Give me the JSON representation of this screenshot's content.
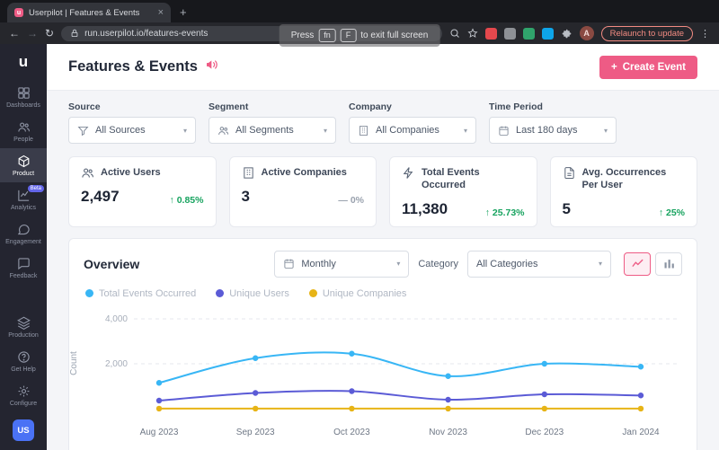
{
  "browser": {
    "tab_title": "Userpilot | Features & Events",
    "favicon_letter": "u",
    "close_glyph": "×",
    "newtab_glyph": "+",
    "back_glyph": "←",
    "forward_glyph": "→",
    "reload_glyph": "↻",
    "url": "run.userpilot.io/features-events",
    "relaunch_label": "Relaunch to update",
    "profile_initial": "A",
    "menu_glyph": "⋮",
    "toast": {
      "prefix": "Press",
      "key1": "fn",
      "key2": "F",
      "suffix": "to exit full screen"
    }
  },
  "sidebar": {
    "logo_letter": "u",
    "items": [
      {
        "label": "Dashboards"
      },
      {
        "label": "People"
      },
      {
        "label": "Product"
      },
      {
        "label": "Analytics",
        "badge": "Beta"
      },
      {
        "label": "Engagement"
      },
      {
        "label": "Feedback"
      }
    ],
    "bottom_items": [
      {
        "label": "Production"
      },
      {
        "label": "Get Help"
      },
      {
        "label": "Configure"
      }
    ],
    "workspace_initials": "US"
  },
  "header": {
    "title": "Features & Events",
    "plus": "+",
    "create_event_label": "Create Event"
  },
  "filters": [
    {
      "label": "Source",
      "value": "All Sources"
    },
    {
      "label": "Segment",
      "value": "All Segments"
    },
    {
      "label": "Company",
      "value": "All Companies"
    },
    {
      "label": "Time Period",
      "value": "Last 180 days"
    }
  ],
  "chevron": "▾",
  "stats": [
    {
      "label": "Active Users",
      "value": "2,497",
      "change": "↑ 0.85%"
    },
    {
      "label": "Active Companies",
      "value": "3",
      "change": "— 0%"
    },
    {
      "label": "Total Events Occurred",
      "value": "11,380",
      "change": "↑ 25.73%"
    },
    {
      "label": "Avg. Occurrences Per User",
      "value": "5",
      "change": "↑ 25%"
    }
  ],
  "overview": {
    "title": "Overview",
    "period_value": "Monthly",
    "category_label": "Category",
    "category_value": "All Categories",
    "legend": [
      "Total Events Occurred",
      "Unique Users",
      "Unique Companies"
    ]
  },
  "chart_data": {
    "type": "line",
    "x": [
      "Aug 2023",
      "Sep 2023",
      "Oct 2023",
      "Nov 2023",
      "Dec 2023",
      "Jan 2024"
    ],
    "series": [
      {
        "name": "Total Events Occurred",
        "color": "#38b6f5",
        "values": [
          1150,
          2250,
          2450,
          1450,
          2000,
          1870
        ]
      },
      {
        "name": "Unique Users",
        "color": "#5b5bd6",
        "values": [
          360,
          700,
          780,
          400,
          640,
          590
        ]
      },
      {
        "name": "Unique Companies",
        "color": "#e7b416",
        "values": [
          3,
          3,
          3,
          3,
          3,
          3
        ]
      }
    ],
    "ylabel": "Count",
    "ylim": [
      0,
      4000
    ],
    "yticks": [
      2000,
      4000
    ],
    "grid": "dashed-horizontal",
    "legend_position": "top-left"
  }
}
